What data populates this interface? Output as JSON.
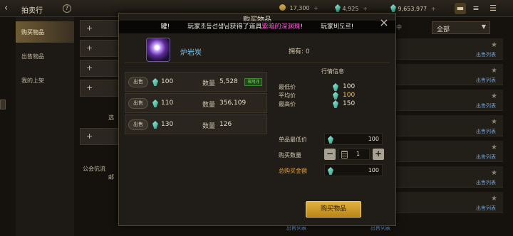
{
  "topbar": {
    "back_icon": "back-arrow-icon",
    "title": "拍卖行",
    "help_symbol": "?",
    "currencies": [
      {
        "icon": "gold-coin-icon",
        "value": "17,300",
        "color": "#c9a24a"
      },
      {
        "icon": "gem-icon",
        "value": "4,925",
        "color": "#3cc0a0"
      },
      {
        "icon": "gem-icon",
        "value": "9,653,977",
        "color": "#3cc0a0"
      }
    ],
    "plus": "+",
    "right_icons": [
      "chest-icon",
      "stack-icon",
      "menu-icon"
    ]
  },
  "sidebar": {
    "items": [
      {
        "label": "购买物品",
        "active": true
      },
      {
        "label": "出售物品",
        "active": false
      },
      {
        "label": "我的上架",
        "active": false
      }
    ]
  },
  "categories": {
    "buttons": [
      "+",
      "+",
      "+",
      "+",
      "+"
    ],
    "text1": "选",
    "text2": "公会伉流",
    "text3": "邮"
  },
  "right_list": {
    "dropdown_value": "全部",
    "dropdown_prefix": "中",
    "link_label": "出售列表"
  },
  "modal": {
    "title": "购买物品",
    "close_symbol": "×",
    "notice": {
      "prefix": "罐!",
      "body": "玩家초등선생님获得了道具",
      "highlight": "紫暗的深渊珠",
      "suffix": "!",
      "tail": "玩家비도르!"
    },
    "item": {
      "name": "炉岩炭",
      "owned_label": "拥有:",
      "owned_count": "0"
    },
    "listings": [
      {
        "button": "出售",
        "price": "100",
        "qty_label": "数量",
        "qty": "5,528",
        "badge": "최저가"
      },
      {
        "button": "出售",
        "price": "110",
        "qty_label": "数量",
        "qty": "356,109",
        "badge": ""
      },
      {
        "button": "出售",
        "price": "130",
        "qty_label": "数量",
        "qty": "126",
        "badge": ""
      }
    ],
    "market": {
      "heading": "行情信息",
      "min_label": "最低价",
      "min_value": "100",
      "avg_label": "平均价",
      "avg_value": "100",
      "max_label": "最高价",
      "max_value": "150"
    },
    "purchase": {
      "unit_label": "单品最低价",
      "unit_value": "100",
      "qty_label": "购买数量",
      "qty_value": "1",
      "minus": "−",
      "plus": "+",
      "total_label": "总购买金额",
      "total_value": "100"
    },
    "buy_button": "购买物品"
  },
  "colors": {
    "accent_gold": "#d9a838",
    "gem_teal": "#3cc0a0",
    "highlight_pink": "#ff58d6",
    "lowest_green": "#8ef07a"
  }
}
